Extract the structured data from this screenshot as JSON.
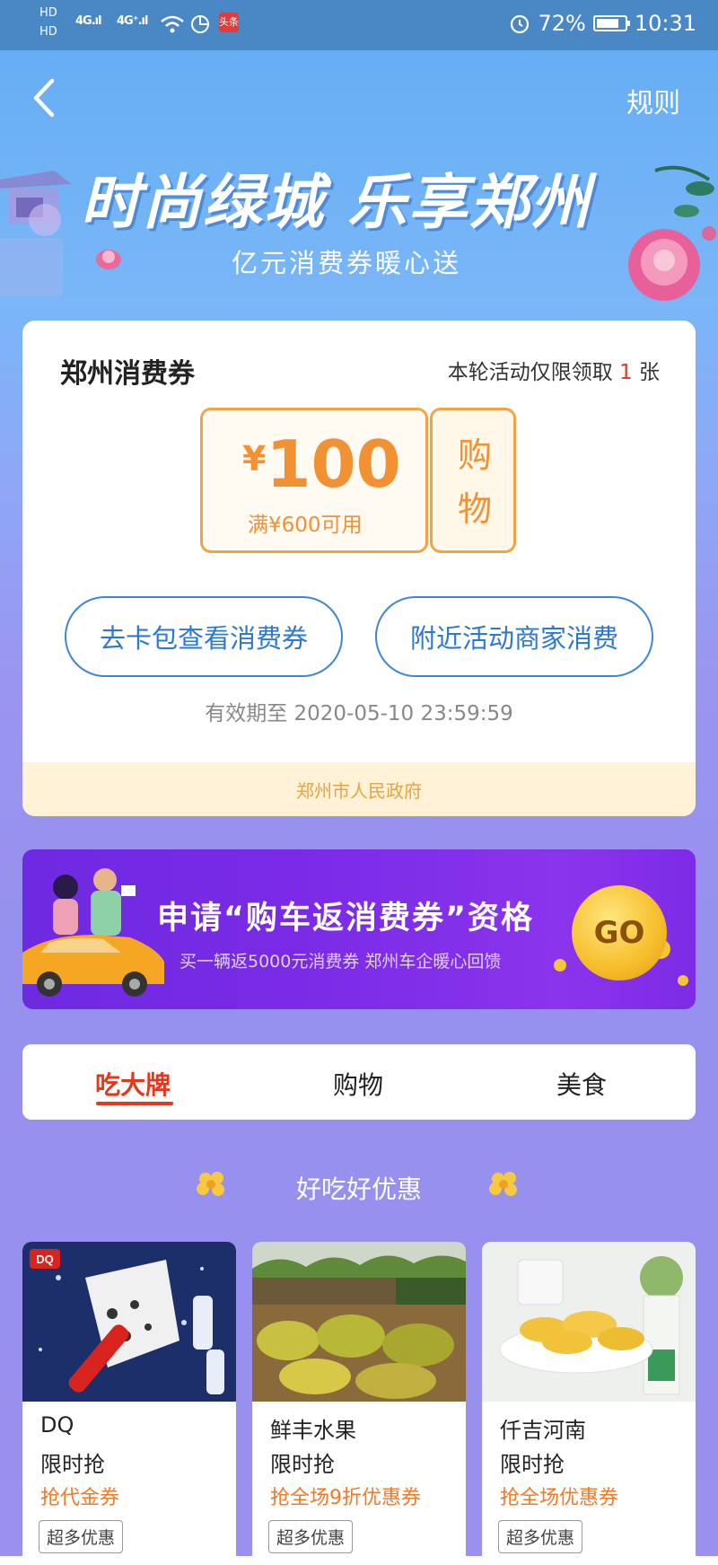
{
  "status_bar": {
    "hd1": "HD",
    "hd2": "HD",
    "sim1": "4G",
    "sim2": "4G⁺",
    "app_badge": "头条",
    "battery": "72%",
    "time": "10:31"
  },
  "header": {
    "rules_label": "规则"
  },
  "hero": {
    "title": "时尚绿城 乐享郑州",
    "subtitle": "亿元消费券暖心送"
  },
  "coupon_card": {
    "title": "郑州消费券",
    "limit_prefix": "本轮活动仅限领取",
    "limit_count": "1",
    "limit_suffix": "张",
    "currency": "¥",
    "amount": "100",
    "condition": "满¥600可用",
    "type": "购物",
    "button_wallet": "去卡包查看消费券",
    "button_nearby": "附近活动商家消费",
    "validity": "有效期至 2020-05-10 23:59:59",
    "issuer": "郑州市人民政府"
  },
  "promo_banner": {
    "title": "申请“购车返消费券”资格",
    "subtitle": "买一辆返5000元消费券 郑州车企暖心回馈",
    "go_label": "GO"
  },
  "tabs": [
    {
      "label": "吃大牌",
      "active": true
    },
    {
      "label": "购物",
      "active": false
    },
    {
      "label": "美食",
      "active": false
    }
  ],
  "section_title": "好吃好优惠",
  "products": [
    {
      "name": "DQ",
      "tag": "限时抢",
      "offer": "抢代金券",
      "badge": "超多优惠",
      "logo": "DQ"
    },
    {
      "name": "鲜丰水果",
      "tag": "限时抢",
      "offer": "抢全场9折优惠券",
      "badge": "超多优惠"
    },
    {
      "name": "仟吉河南",
      "tag": "限时抢",
      "offer": "抢全场优惠券",
      "badge": "超多优惠"
    }
  ],
  "colors": {
    "accent_red": "#e03a1e",
    "coupon_orange": "#f29133",
    "button_blue": "#3f86d8",
    "banner_purple": "#7a2ae6"
  }
}
